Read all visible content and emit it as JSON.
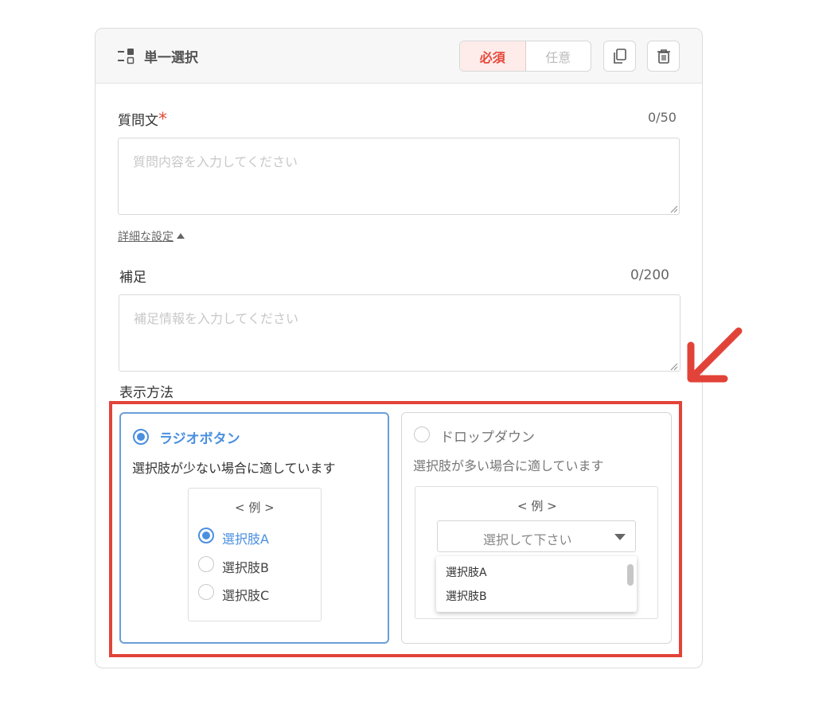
{
  "header": {
    "type_icon": "single-choice-icon",
    "type_label": "単一選択",
    "toggle": {
      "required_label": "必須",
      "optional_label": "任意",
      "selected": "required"
    },
    "copy_icon": "copy-icon",
    "trash_icon": "trash-icon"
  },
  "question": {
    "label": "質問文",
    "required_mark": "*",
    "counter": "0/50",
    "placeholder": "質問内容を入力してください",
    "value": ""
  },
  "detail_toggle": {
    "label": "詳細な設定",
    "icon": "caret-up-icon"
  },
  "supplement": {
    "label": "補足",
    "counter": "0/200",
    "placeholder": "補足情報を入力してください",
    "value": ""
  },
  "display": {
    "label": "表示方法",
    "selected": "radio",
    "radio_option": {
      "title": "ラジオボタン",
      "description": "選択肢が少ない場合に適しています",
      "example_label": "< 例 >",
      "choices": [
        "選択肢A",
        "選択肢B",
        "選択肢C"
      ],
      "selected_choice": "選択肢A"
    },
    "dropdown_option": {
      "title": "ドロップダウン",
      "description": "選択肢が多い場合に適しています",
      "example_label": "< 例 >",
      "select_placeholder": "選択して下さい",
      "list_items": [
        "選択肢A",
        "選択肢B"
      ]
    }
  },
  "colors": {
    "accent_blue": "#4a8fe0",
    "required_red": "#e5483b",
    "annotation_red": "#e24338"
  },
  "annotation": {
    "arrow_icon": "annotation-arrow-icon"
  }
}
